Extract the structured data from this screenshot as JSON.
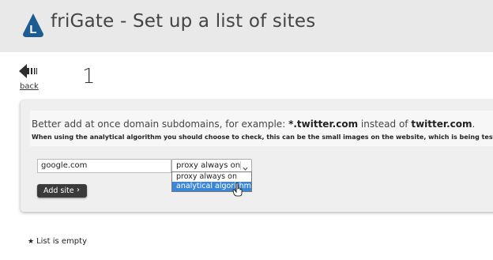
{
  "header": {
    "logo_letter": "L",
    "title": "friGate - Set up a list of sites"
  },
  "nav": {
    "back_label": "back",
    "list_count": "1"
  },
  "hint": {
    "line1_prefix": "Better add at once domain subdomains, for example: ",
    "line1_example": "*.twitter.com",
    "line1_middle": " instead of ",
    "line1_domain": "twitter.com",
    "line1_suffix": ".",
    "line2": "When using the analytical algorithm you should choose to check, this can be the small images on the website, which is being tested."
  },
  "form": {
    "site_value": "google.com",
    "mode_selected": "proxy always on",
    "mode_options": [
      "proxy always on",
      "analytical algorithm"
    ],
    "mode_highlighted": "analytical algorithm",
    "add_button_label": "Add site",
    "add_button_arrow": "›"
  },
  "list": {
    "empty_icon": "★",
    "empty_text": "List is empty"
  },
  "colors": {
    "header_bg": "#e9e9e9",
    "logo_bg": "#1d5c93",
    "option_highlight": "#3b86d6",
    "button_bg": "#3a3a3a"
  }
}
